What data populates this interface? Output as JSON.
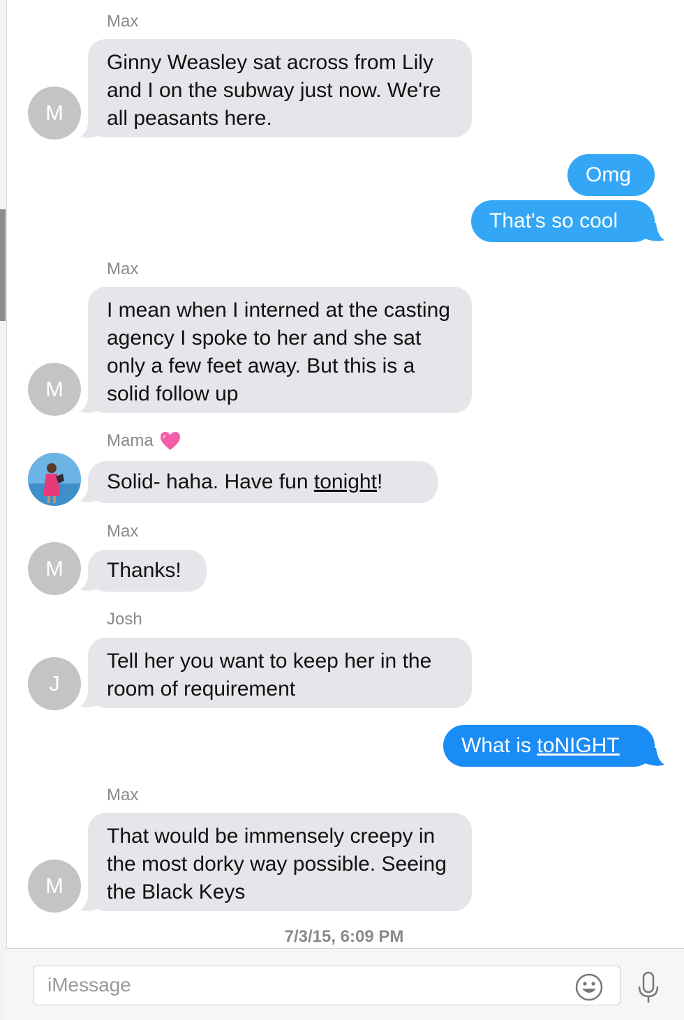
{
  "conversation": {
    "groups": [
      {
        "sender": "Max",
        "avatar_initial": "M",
        "message": "Ginny Weasley sat across from Lily and I on the subway just now. We're all peasants here."
      },
      {
        "sent": [
          "Omg",
          "That's so cool"
        ]
      },
      {
        "sender": "Max",
        "avatar_initial": "M",
        "message": "I mean when I interned at the casting agency I spoke to her and she sat only a few feet away. But this is a solid follow up"
      },
      {
        "sender": "Mama",
        "sender_emoji": "pink-heart-icon",
        "message_before_link": "Solid- haha. Have fun ",
        "message_link": "tonight",
        "message_after_link": "!"
      },
      {
        "sender": "Max",
        "avatar_initial": "M",
        "message": "Thanks!"
      },
      {
        "sender": "Josh",
        "avatar_initial": "J",
        "message": "Tell her you want to keep her in the room of requirement"
      },
      {
        "sent_before_link": "What is ",
        "sent_link": "toNIGHT"
      },
      {
        "sender": "Max",
        "avatar_initial": "M",
        "message": "That would be immensely creepy in the most dorky way possible. Seeing the Black Keys"
      }
    ]
  },
  "timestamp": "7/3/15, 6:09 PM",
  "composer": {
    "placeholder": "iMessage",
    "emoji_icon": "emoji-smiley-icon",
    "mic_icon": "microphone-icon"
  },
  "colors": {
    "received_bubble": "#e5e5ea",
    "sent_bubble": "#33a7f6",
    "sent_bubble_imessage": "#1a8cf5",
    "link_heart": "#f25fa8"
  }
}
